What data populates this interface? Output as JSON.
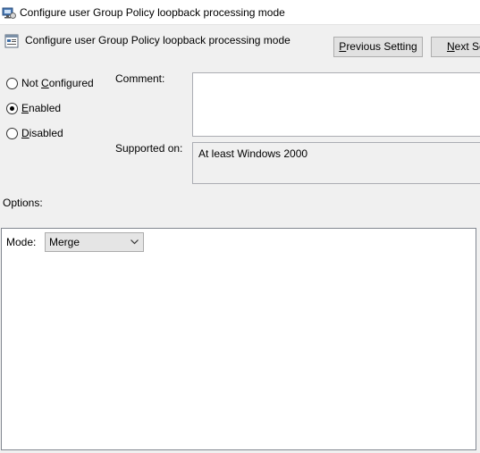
{
  "window": {
    "title": "Configure user Group Policy loopback processing mode"
  },
  "header": {
    "policy_name": "Configure user Group Policy loopback processing mode",
    "previous_setting": {
      "mnemonic": "P",
      "rest": "revious Setting"
    },
    "next_setting": {
      "mnemonic": "N",
      "rest": "ext Se"
    }
  },
  "state": {
    "options": [
      {
        "pre": "Not ",
        "mnemonic": "C",
        "post": "onfigured",
        "selected": false
      },
      {
        "pre": "",
        "mnemonic": "E",
        "post": "nabled",
        "selected": true
      },
      {
        "pre": "",
        "mnemonic": "D",
        "post": "isabled",
        "selected": false
      }
    ]
  },
  "fields": {
    "comment_label": "Comment:",
    "comment_value": "",
    "supported_label": "Supported on:",
    "supported_value": "At least Windows 2000"
  },
  "options": {
    "label": "Options:",
    "mode_label": "Mode:",
    "mode_value": "Merge"
  },
  "icons": {
    "title": "group-policy-icon",
    "policy": "policy-setting-icon",
    "dropdown": "chevron-down-icon"
  }
}
